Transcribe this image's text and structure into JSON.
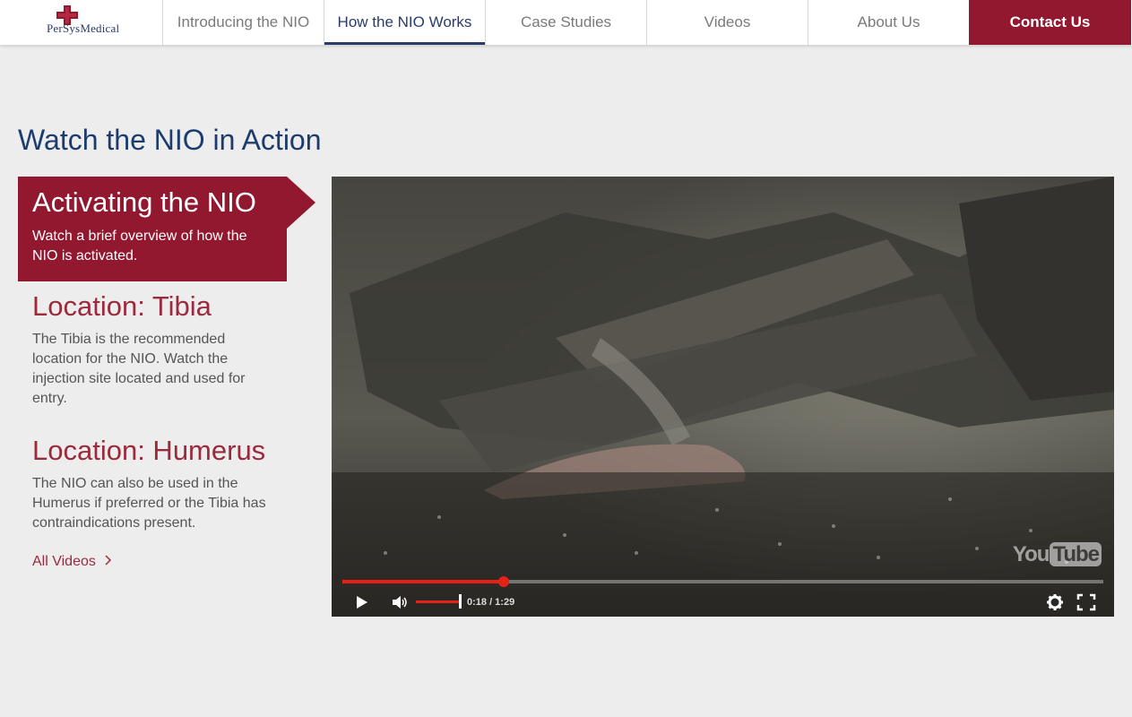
{
  "header": {
    "logo_text": "PerSysMedical",
    "nav": [
      {
        "label": "Introducing the NIO",
        "active": false
      },
      {
        "label": "How the NIO Works",
        "active": true
      },
      {
        "label": "Case Studies",
        "active": false
      },
      {
        "label": "Videos",
        "active": false
      },
      {
        "label": "About Us",
        "active": false
      },
      {
        "label": "Contact Us",
        "active": false
      }
    ]
  },
  "main": {
    "title": "Watch the NIO in Action",
    "videos": [
      {
        "title": "Activating the NIO",
        "description": "Watch a brief overview of how the NIO is activated.",
        "active": true
      },
      {
        "title": "Location: Tibia",
        "description": "The Tibia is the recommended location for the NIO. Watch the injection site located and used for entry.",
        "active": false
      },
      {
        "title": "Location: Humerus",
        "description": "The NIO can also be used in the Humerus if preferred or the Tibia has contraindications present.",
        "active": false
      }
    ],
    "all_videos_label": "All Videos",
    "all_videos_icon": "chevron-right-icon"
  },
  "player": {
    "brand": {
      "you": "You",
      "tube": "Tube"
    },
    "current_time": "0:18",
    "duration": "1:29",
    "time_display": "0:18 / 1:29",
    "progress": 0.212,
    "volume": 1.0,
    "icons": [
      "play-icon",
      "volume-icon",
      "settings-icon",
      "fullscreen-icon"
    ]
  },
  "colors": {
    "brand_red": "#921830",
    "brand_blue": "#1d3c6e",
    "progress_red": "#e62117",
    "background": "#ededed"
  }
}
